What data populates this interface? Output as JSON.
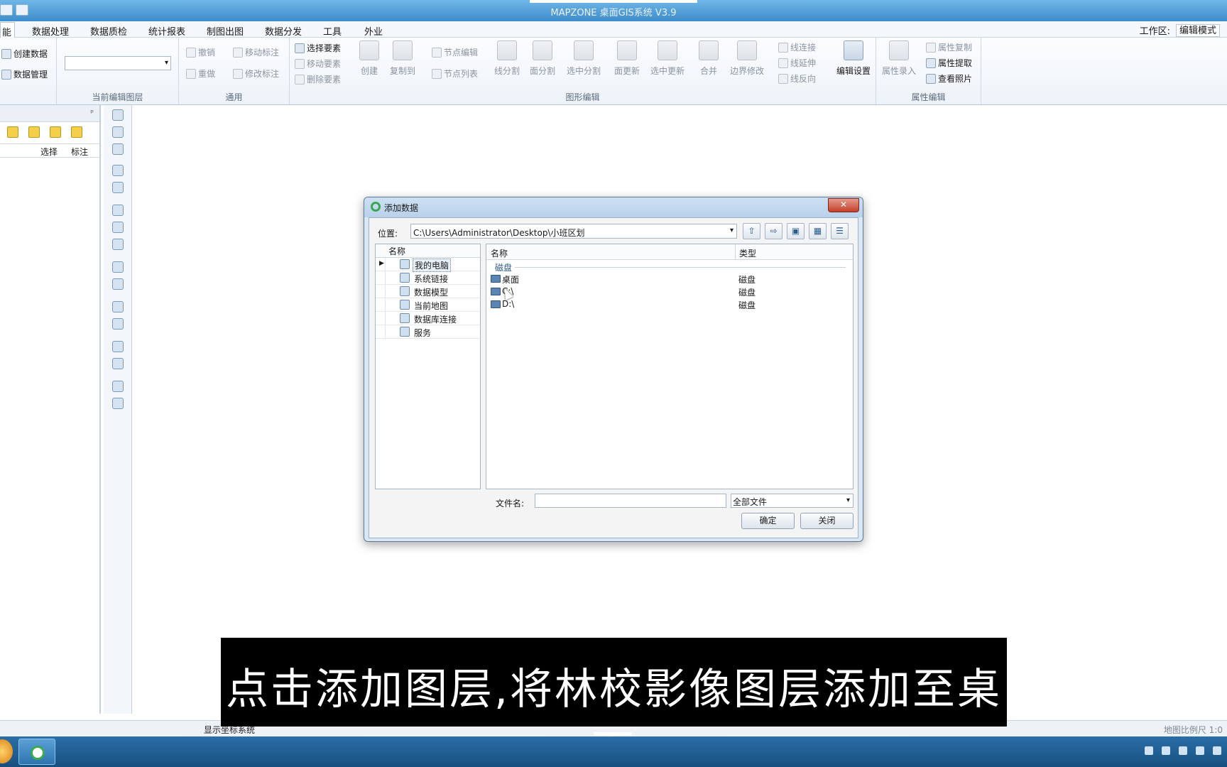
{
  "window": {
    "title": "MAPZONE 桌面GIS系统 V3.9"
  },
  "menu": {
    "tabs": [
      "能",
      "数据处理",
      "数据质检",
      "统计报表",
      "制图出图",
      "数据分发",
      "工具",
      "外业"
    ],
    "workspace_label": "工作区:",
    "workspace_mode": "编辑模式"
  },
  "ribbon": {
    "group1": {
      "create_data": "创建数据",
      "data_manage": "数据管理"
    },
    "group2": {
      "label": "当前编辑图层"
    },
    "general": {
      "label": "通用",
      "undo": "撤销",
      "redo": "重做",
      "move_label": "移动标注",
      "edit_label": "修改标注"
    },
    "shape": {
      "label": "图形编辑",
      "select_feature": "选择要素",
      "move_feature": "移动要素",
      "delete_feature": "删除要素",
      "create": "创建",
      "copy_to": "复制到",
      "node_edit": "节点编辑",
      "node_list": "节点列表",
      "line_split": "线分割",
      "face_split": "面分割",
      "select_split": "选中分割",
      "face_update": "面更新",
      "select_update": "选中更新",
      "merge": "合并",
      "boundary_modify": "边界修改",
      "line_connect": "线连接",
      "line_extend": "线延伸",
      "line_reverse": "线反向",
      "edit_settings": "编辑设置"
    },
    "attr": {
      "label": "属性编辑",
      "attr_input": "属性录入",
      "attr_copy": "属性复制",
      "attr_extract": "属性提取",
      "view_photo": "查看照片"
    }
  },
  "left_panel": {
    "pin": "ᵖ",
    "col_select": "选择",
    "col_label": "标注"
  },
  "dialog": {
    "title": "添加数据",
    "close": "✕",
    "location_label": "位置:",
    "location_value": "C:\\Users\\Administrator\\Desktop\\小班区划",
    "tree_header": "名称",
    "tree_items": [
      "我的电脑",
      "系统链接",
      "数据模型",
      "当前地图",
      "数据库连接",
      "服务"
    ],
    "list_col_name": "名称",
    "list_col_type": "类型",
    "group_label": "磁盘",
    "files": [
      {
        "name": "桌面",
        "type": "磁盘"
      },
      {
        "name": "C:\\",
        "type": "磁盘"
      },
      {
        "name": "D:\\",
        "type": "磁盘"
      }
    ],
    "filename_label": "文件名:",
    "filename_value": "",
    "filetype_value": "全部文件",
    "ok": "确定",
    "cancel": "关闭"
  },
  "status": {
    "coord": "显示坐标系统",
    "scale": "地图比例尺 1:0"
  },
  "subtitle": "点击添加图层,将林校影像图层添加至桌面"
}
